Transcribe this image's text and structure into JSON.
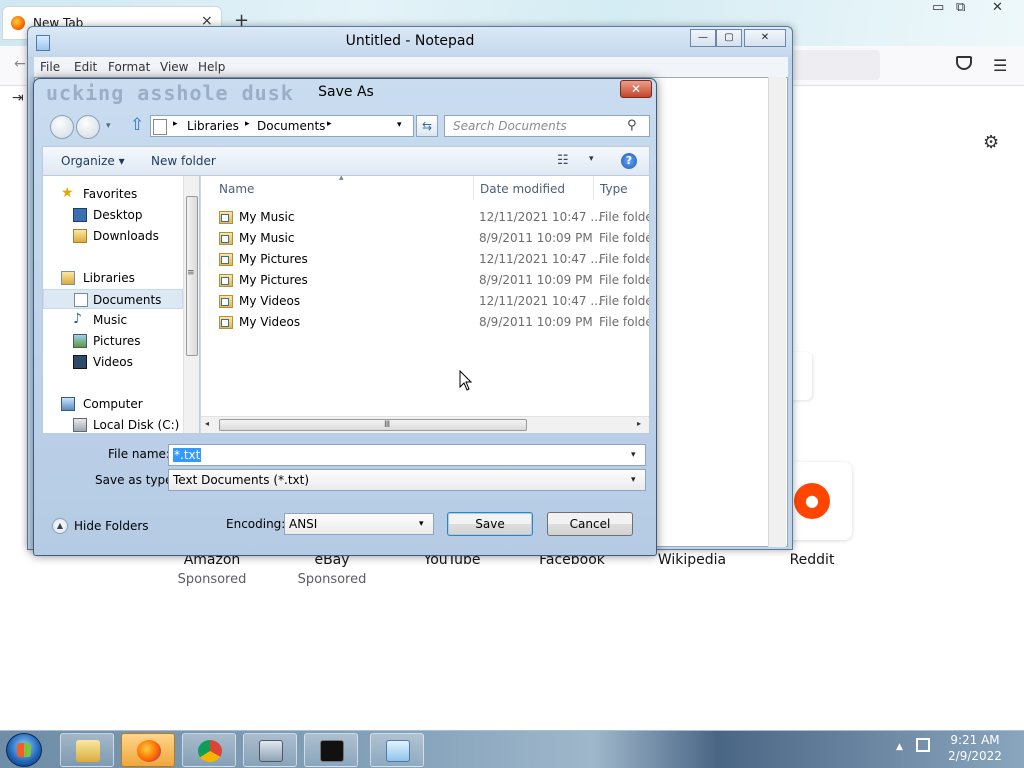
{
  "browser": {
    "tab_label": "New Tab",
    "tab_close": "×",
    "new_tab": "+",
    "controls": {
      "min": "▭",
      "restore": "⧉",
      "close": "✕"
    },
    "menu_icon": "☰",
    "back_icon": "←",
    "login_icon": "⇥",
    "gear_icon": "⚙",
    "reddit_logo": "●",
    "sites": [
      {
        "name": "Amazon",
        "sub": "Sponsored"
      },
      {
        "name": "eBay",
        "sub": "Sponsored"
      },
      {
        "name": "YouTube",
        "sub": ""
      },
      {
        "name": "Facebook",
        "sub": ""
      },
      {
        "name": "Wikipedia",
        "sub": ""
      },
      {
        "name": "Reddit",
        "sub": ""
      }
    ]
  },
  "notepad": {
    "title": "Untitled - Notepad",
    "menu": [
      "File",
      "Edit",
      "Format",
      "View",
      "Help"
    ],
    "controls": {
      "min": "—",
      "restore": "▢",
      "close": "✕"
    }
  },
  "dialog": {
    "title": "Save As",
    "watermark": "ucking asshole dusk",
    "close": "✕",
    "up_arrow": "⇧",
    "breadcrumb": [
      "Libraries",
      "Documents"
    ],
    "crumb_sep": "▸",
    "refresh": "⇆",
    "search_placeholder": "Search Documents",
    "search_icon": "⚲",
    "organize": "Organize ▾",
    "new_folder": "New folder",
    "views": "☷",
    "views_dd": "▾",
    "help": "?",
    "nav": {
      "favorites": "Favorites",
      "desktop": "Desktop",
      "downloads": "Downloads",
      "libraries": "Libraries",
      "documents": "Documents",
      "music": "Music",
      "pictures": "Pictures",
      "videos": "Videos",
      "computer": "Computer",
      "local_disk": "Local Disk (C:)"
    },
    "columns": {
      "name": "Name",
      "date": "Date modified",
      "type": "Type"
    },
    "sort_arrow": "▴",
    "files": [
      {
        "name": "My Music",
        "date": "12/11/2021 10:47 ...",
        "type": "File folder"
      },
      {
        "name": "My Music",
        "date": "8/9/2011 10:09 PM",
        "type": "File folder"
      },
      {
        "name": "My Pictures",
        "date": "12/11/2021 10:47 ...",
        "type": "File folder"
      },
      {
        "name": "My Pictures",
        "date": "8/9/2011 10:09 PM",
        "type": "File folder"
      },
      {
        "name": "My Videos",
        "date": "12/11/2021 10:47 ...",
        "type": "File folder"
      },
      {
        "name": "My Videos",
        "date": "8/9/2011 10:09 PM",
        "type": "File folder"
      }
    ],
    "scroll": {
      "left": "◂",
      "right": "▸",
      "grip": "Ⅲ",
      "vgrip": "≡"
    },
    "file_name_label": "File name:",
    "file_name_value": "*.txt",
    "save_type_label": "Save as type:",
    "save_type_value": "Text Documents (*.txt)",
    "dropdown": "▾",
    "hide_folders": "Hide Folders",
    "hide_folders_icon": "▲",
    "encoding_label": "Encoding:",
    "encoding_value": "ANSI",
    "save_button": "Save",
    "cancel_button": "Cancel"
  },
  "taskbar": {
    "tray_arrow": "▲",
    "time": "9:21 AM",
    "date": "2/9/2022"
  }
}
